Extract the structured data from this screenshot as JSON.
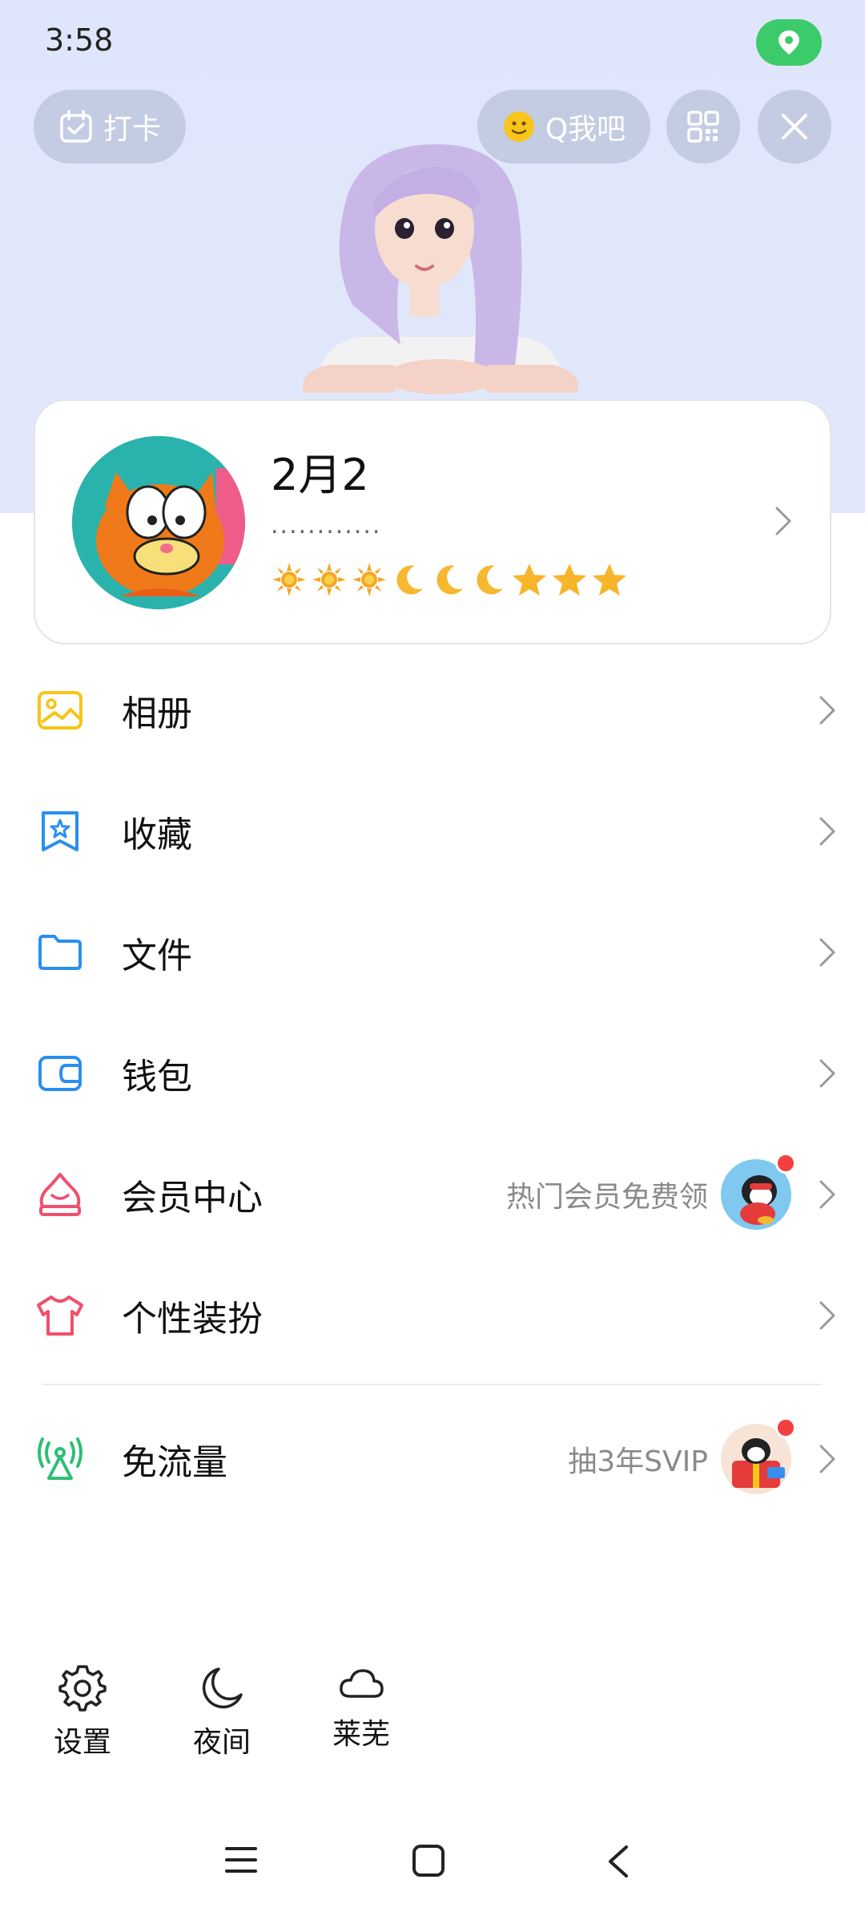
{
  "status_bar": {
    "time": "3:58",
    "location_icon": "location-pin-icon"
  },
  "top_actions": {
    "checkin_label": "打卡",
    "qbar_label": "Q我吧",
    "qr_icon": "qr-code-icon",
    "close_icon": "close-icon"
  },
  "profile": {
    "name": "2月2",
    "signature": "............",
    "level_icons": [
      "sun",
      "sun",
      "sun",
      "moon",
      "moon",
      "moon",
      "star",
      "star",
      "star"
    ]
  },
  "menu": [
    {
      "label": "相册",
      "icon": "album-icon",
      "color": "#f5c518"
    },
    {
      "label": "收藏",
      "icon": "favorites-icon",
      "color": "#2a8ff0"
    },
    {
      "label": "文件",
      "icon": "folder-icon",
      "color": "#2a8ff0"
    },
    {
      "label": "钱包",
      "icon": "wallet-icon",
      "color": "#2a8ff0"
    },
    {
      "label": "会员中心",
      "icon": "vip-icon",
      "color": "#f0506e",
      "hint": "热门会员免费领"
    },
    {
      "label": "个性装扮",
      "icon": "tshirt-icon",
      "color": "#f0506e"
    },
    {
      "label": "免流量",
      "icon": "data-free-icon",
      "color": "#2dbf75",
      "hint": "抽3年SVIP"
    }
  ],
  "bottom_tools": [
    {
      "label": "设置",
      "icon": "gear-icon"
    },
    {
      "label": "夜间",
      "icon": "moon-icon"
    },
    {
      "label": "莱芜",
      "icon": "cloud-icon"
    }
  ],
  "navbar": {
    "menu_icon": "menu-icon",
    "home_icon": "home-icon",
    "back_icon": "back-icon"
  }
}
